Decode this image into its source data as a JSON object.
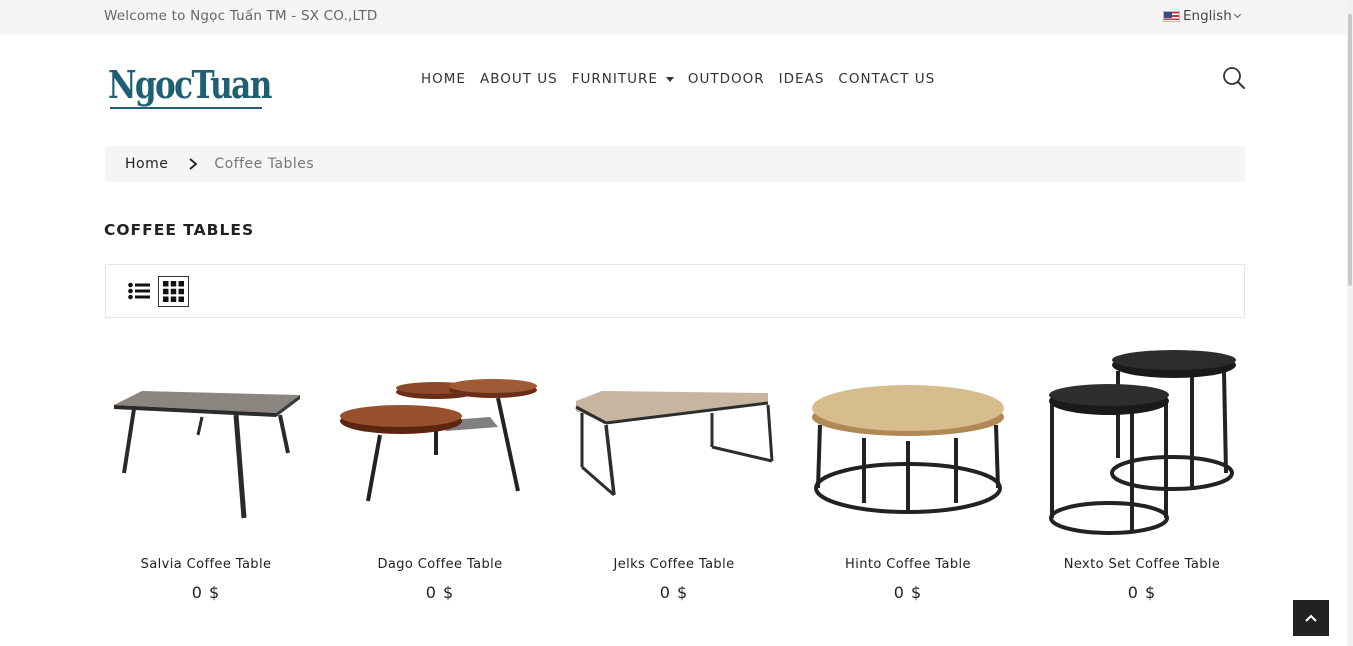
{
  "topbar": {
    "welcome": "Welcome to Ngọc Tuấn TM - SX CO.,LTD",
    "language": "English",
    "flag_icon": "us-flag-icon",
    "chevron_icon": "chevron-down-icon"
  },
  "header": {
    "logo_text": "NgocTuan",
    "brand_color": "#1f5f74",
    "nav": [
      {
        "label": "HOME"
      },
      {
        "label": "ABOUT US"
      },
      {
        "label": "FURNITURE"
      },
      {
        "label": "OUTDOOR"
      },
      {
        "label": "IDEAS"
      },
      {
        "label": "CONTACT US"
      }
    ],
    "search_icon": "search-icon"
  },
  "breadcrumb": {
    "home": "Home",
    "current": "Coffee Tables"
  },
  "page": {
    "title": "COFFEE TABLES"
  },
  "toolbar": {
    "list_view_icon": "list-view-icon",
    "grid_view_icon": "grid-view-icon",
    "active_view": "grid"
  },
  "products": [
    {
      "name": "Salvia Coffee Table",
      "price": "0 $"
    },
    {
      "name": "Dago Coffee Table",
      "price": "0 $"
    },
    {
      "name": "Jelks Coffee Table",
      "price": "0 $"
    },
    {
      "name": "Hinto Coffee Table",
      "price": "0 $"
    },
    {
      "name": "Nexto Set Coffee Table",
      "price": "0 $"
    }
  ],
  "back_to_top_icon": "chevron-up-icon"
}
